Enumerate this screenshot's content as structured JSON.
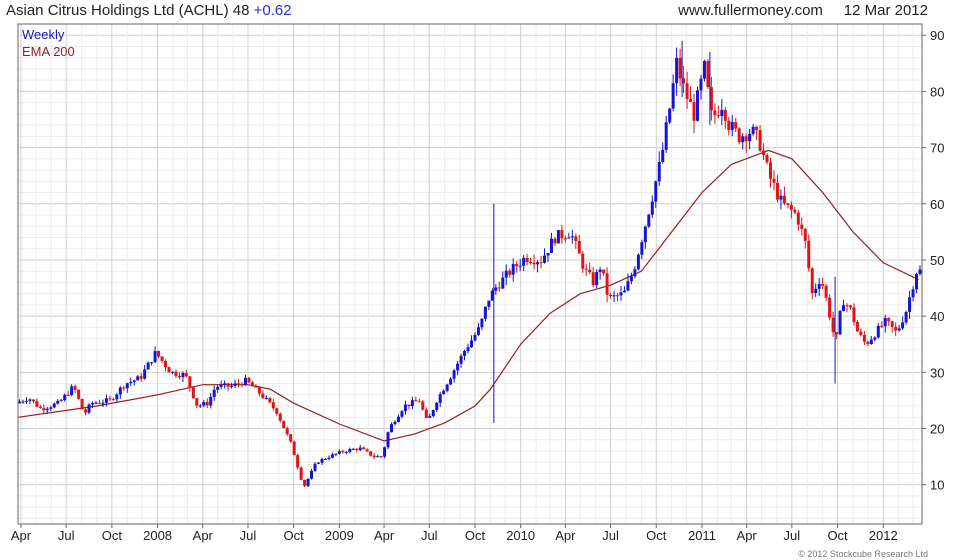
{
  "header": {
    "title": "Asian Citrus Holdings Ltd (ACHL)",
    "price": "48",
    "change": "+0.62",
    "site": "www.fullermoney.com",
    "date": "12 Mar 2012"
  },
  "copyright": "© 2012 Stockcube Research Ltd",
  "colors": {
    "up": "#1414d2",
    "down": "#e01414",
    "ema": "#9b1c1c",
    "grid": "#d8d8d8",
    "frame": "#666666"
  },
  "chart_data": {
    "type": "candlestick",
    "legend": [
      "Weekly",
      "EMA 200"
    ],
    "legend_position": "top-left",
    "y_axis_side": "right",
    "ylim": [
      3,
      92
    ],
    "yticks": [
      10,
      20,
      30,
      40,
      50,
      60,
      70,
      80,
      90
    ],
    "xticks": [
      {
        "label": "Apr",
        "x": "2007-04"
      },
      {
        "label": "Jul",
        "x": "2007-07"
      },
      {
        "label": "Oct",
        "x": "2007-10"
      },
      {
        "label": "2008",
        "x": "2008-01"
      },
      {
        "label": "Apr",
        "x": "2008-04"
      },
      {
        "label": "Jul",
        "x": "2008-07"
      },
      {
        "label": "Oct",
        "x": "2008-10"
      },
      {
        "label": "2009",
        "x": "2009-01"
      },
      {
        "label": "Apr",
        "x": "2009-04"
      },
      {
        "label": "Jul",
        "x": "2009-07"
      },
      {
        "label": "Oct",
        "x": "2009-10"
      },
      {
        "label": "2010",
        "x": "2010-01"
      },
      {
        "label": "Apr",
        "x": "2010-04"
      },
      {
        "label": "Jul",
        "x": "2010-07"
      },
      {
        "label": "Oct",
        "x": "2010-10"
      },
      {
        "label": "2011",
        "x": "2011-01"
      },
      {
        "label": "Apr",
        "x": "2011-04"
      },
      {
        "label": "Jul",
        "x": "2011-07"
      },
      {
        "label": "Oct",
        "x": "2011-10"
      },
      {
        "label": "2012",
        "x": "2012-01"
      }
    ],
    "x_range": [
      "2007-03-26",
      "2012-03-19"
    ],
    "price_path": [
      [
        "2007-03-26",
        24.5
      ],
      [
        "2007-04-20",
        25.5
      ],
      [
        "2007-05-15",
        23.5
      ],
      [
        "2007-06-20",
        24.5
      ],
      [
        "2007-07-20",
        27.5
      ],
      [
        "2007-08-10",
        22.5
      ],
      [
        "2007-08-25",
        24.5
      ],
      [
        "2007-10-01",
        25
      ],
      [
        "2007-11-01",
        28
      ],
      [
        "2007-12-01",
        29
      ],
      [
        "2008-01-01",
        33.5
      ],
      [
        "2008-02-01",
        30
      ],
      [
        "2008-03-01",
        29.5
      ],
      [
        "2008-03-25",
        24
      ],
      [
        "2008-04-15",
        24.5
      ],
      [
        "2008-05-01",
        27.5
      ],
      [
        "2008-06-01",
        27.5
      ],
      [
        "2008-07-01",
        28.5
      ],
      [
        "2008-08-01",
        26
      ],
      [
        "2008-09-01",
        23
      ],
      [
        "2008-10-01",
        17
      ],
      [
        "2008-10-25",
        9.5
      ],
      [
        "2008-11-20",
        14
      ],
      [
        "2008-12-15",
        15
      ],
      [
        "2009-01-15",
        16
      ],
      [
        "2009-02-15",
        16.5
      ],
      [
        "2009-03-15",
        15
      ],
      [
        "2009-04-01",
        15
      ],
      [
        "2009-04-15",
        20
      ],
      [
        "2009-05-15",
        24
      ],
      [
        "2009-06-15",
        25
      ],
      [
        "2009-07-01",
        21
      ],
      [
        "2009-07-20",
        25
      ],
      [
        "2009-08-15",
        29
      ],
      [
        "2009-09-15",
        34
      ],
      [
        "2009-10-15",
        38
      ],
      [
        "2009-11-01",
        43
      ],
      [
        "2009-11-15",
        45
      ],
      [
        "2009-12-15",
        48
      ],
      [
        "2010-01-15",
        50.5
      ],
      [
        "2010-02-15",
        50
      ],
      [
        "2010-03-15",
        54
      ],
      [
        "2010-04-15",
        55
      ],
      [
        "2010-05-15",
        48
      ],
      [
        "2010-06-01",
        46
      ],
      [
        "2010-06-15",
        49
      ],
      [
        "2010-07-01",
        43
      ],
      [
        "2010-08-01",
        44
      ],
      [
        "2010-08-20",
        48
      ],
      [
        "2010-09-15",
        57
      ],
      [
        "2010-10-15",
        68
      ],
      [
        "2010-11-01",
        77
      ],
      [
        "2010-11-15",
        85
      ],
      [
        "2010-12-01",
        80
      ],
      [
        "2010-12-20",
        76
      ],
      [
        "2011-01-10",
        84
      ],
      [
        "2011-01-25",
        75
      ],
      [
        "2011-02-15",
        78
      ],
      [
        "2011-03-01",
        74
      ],
      [
        "2011-03-20",
        72
      ],
      [
        "2011-04-15",
        73
      ],
      [
        "2011-05-01",
        71
      ],
      [
        "2011-05-20",
        65
      ],
      [
        "2011-06-15",
        60
      ],
      [
        "2011-07-15",
        58
      ],
      [
        "2011-08-01",
        53
      ],
      [
        "2011-08-15",
        44
      ],
      [
        "2011-09-01",
        47
      ],
      [
        "2011-09-15",
        42
      ],
      [
        "2011-10-01",
        35
      ],
      [
        "2011-10-15",
        43
      ],
      [
        "2011-11-01",
        41
      ],
      [
        "2011-11-15",
        37
      ],
      [
        "2011-12-01",
        35
      ],
      [
        "2011-12-20",
        37
      ],
      [
        "2012-01-10",
        39
      ],
      [
        "2012-02-01",
        37
      ],
      [
        "2012-02-20",
        41
      ],
      [
        "2012-03-12",
        48
      ]
    ],
    "ema_200": [
      [
        "2007-03-26",
        22
      ],
      [
        "2007-09-01",
        24
      ],
      [
        "2008-01-01",
        26
      ],
      [
        "2008-04-01",
        27.8
      ],
      [
        "2008-07-01",
        27.8
      ],
      [
        "2008-08-15",
        27
      ],
      [
        "2008-10-01",
        24.5
      ],
      [
        "2009-01-01",
        20.8
      ],
      [
        "2009-04-01",
        17.8
      ],
      [
        "2009-06-01",
        19
      ],
      [
        "2009-08-01",
        21
      ],
      [
        "2009-10-01",
        24
      ],
      [
        "2009-11-01",
        27
      ],
      [
        "2010-01-01",
        35
      ],
      [
        "2010-03-01",
        40.5
      ],
      [
        "2010-05-01",
        44
      ],
      [
        "2010-07-01",
        45.5
      ],
      [
        "2010-09-01",
        48
      ],
      [
        "2010-11-01",
        55
      ],
      [
        "2011-01-01",
        62
      ],
      [
        "2011-03-01",
        67
      ],
      [
        "2011-05-15",
        69.5
      ],
      [
        "2011-07-01",
        68
      ],
      [
        "2011-09-01",
        62
      ],
      [
        "2011-11-01",
        55
      ],
      [
        "2012-01-01",
        49.5
      ],
      [
        "2012-03-12",
        46.5
      ]
    ],
    "spikes": [
      {
        "date": "2009-11-08",
        "high": 60,
        "low": 21
      },
      {
        "date": "2010-11-22",
        "high": 89,
        "low": 79
      },
      {
        "date": "2011-01-17",
        "high": 87,
        "low": 74
      },
      {
        "date": "2011-09-26",
        "high": 47,
        "low": 28
      }
    ]
  }
}
